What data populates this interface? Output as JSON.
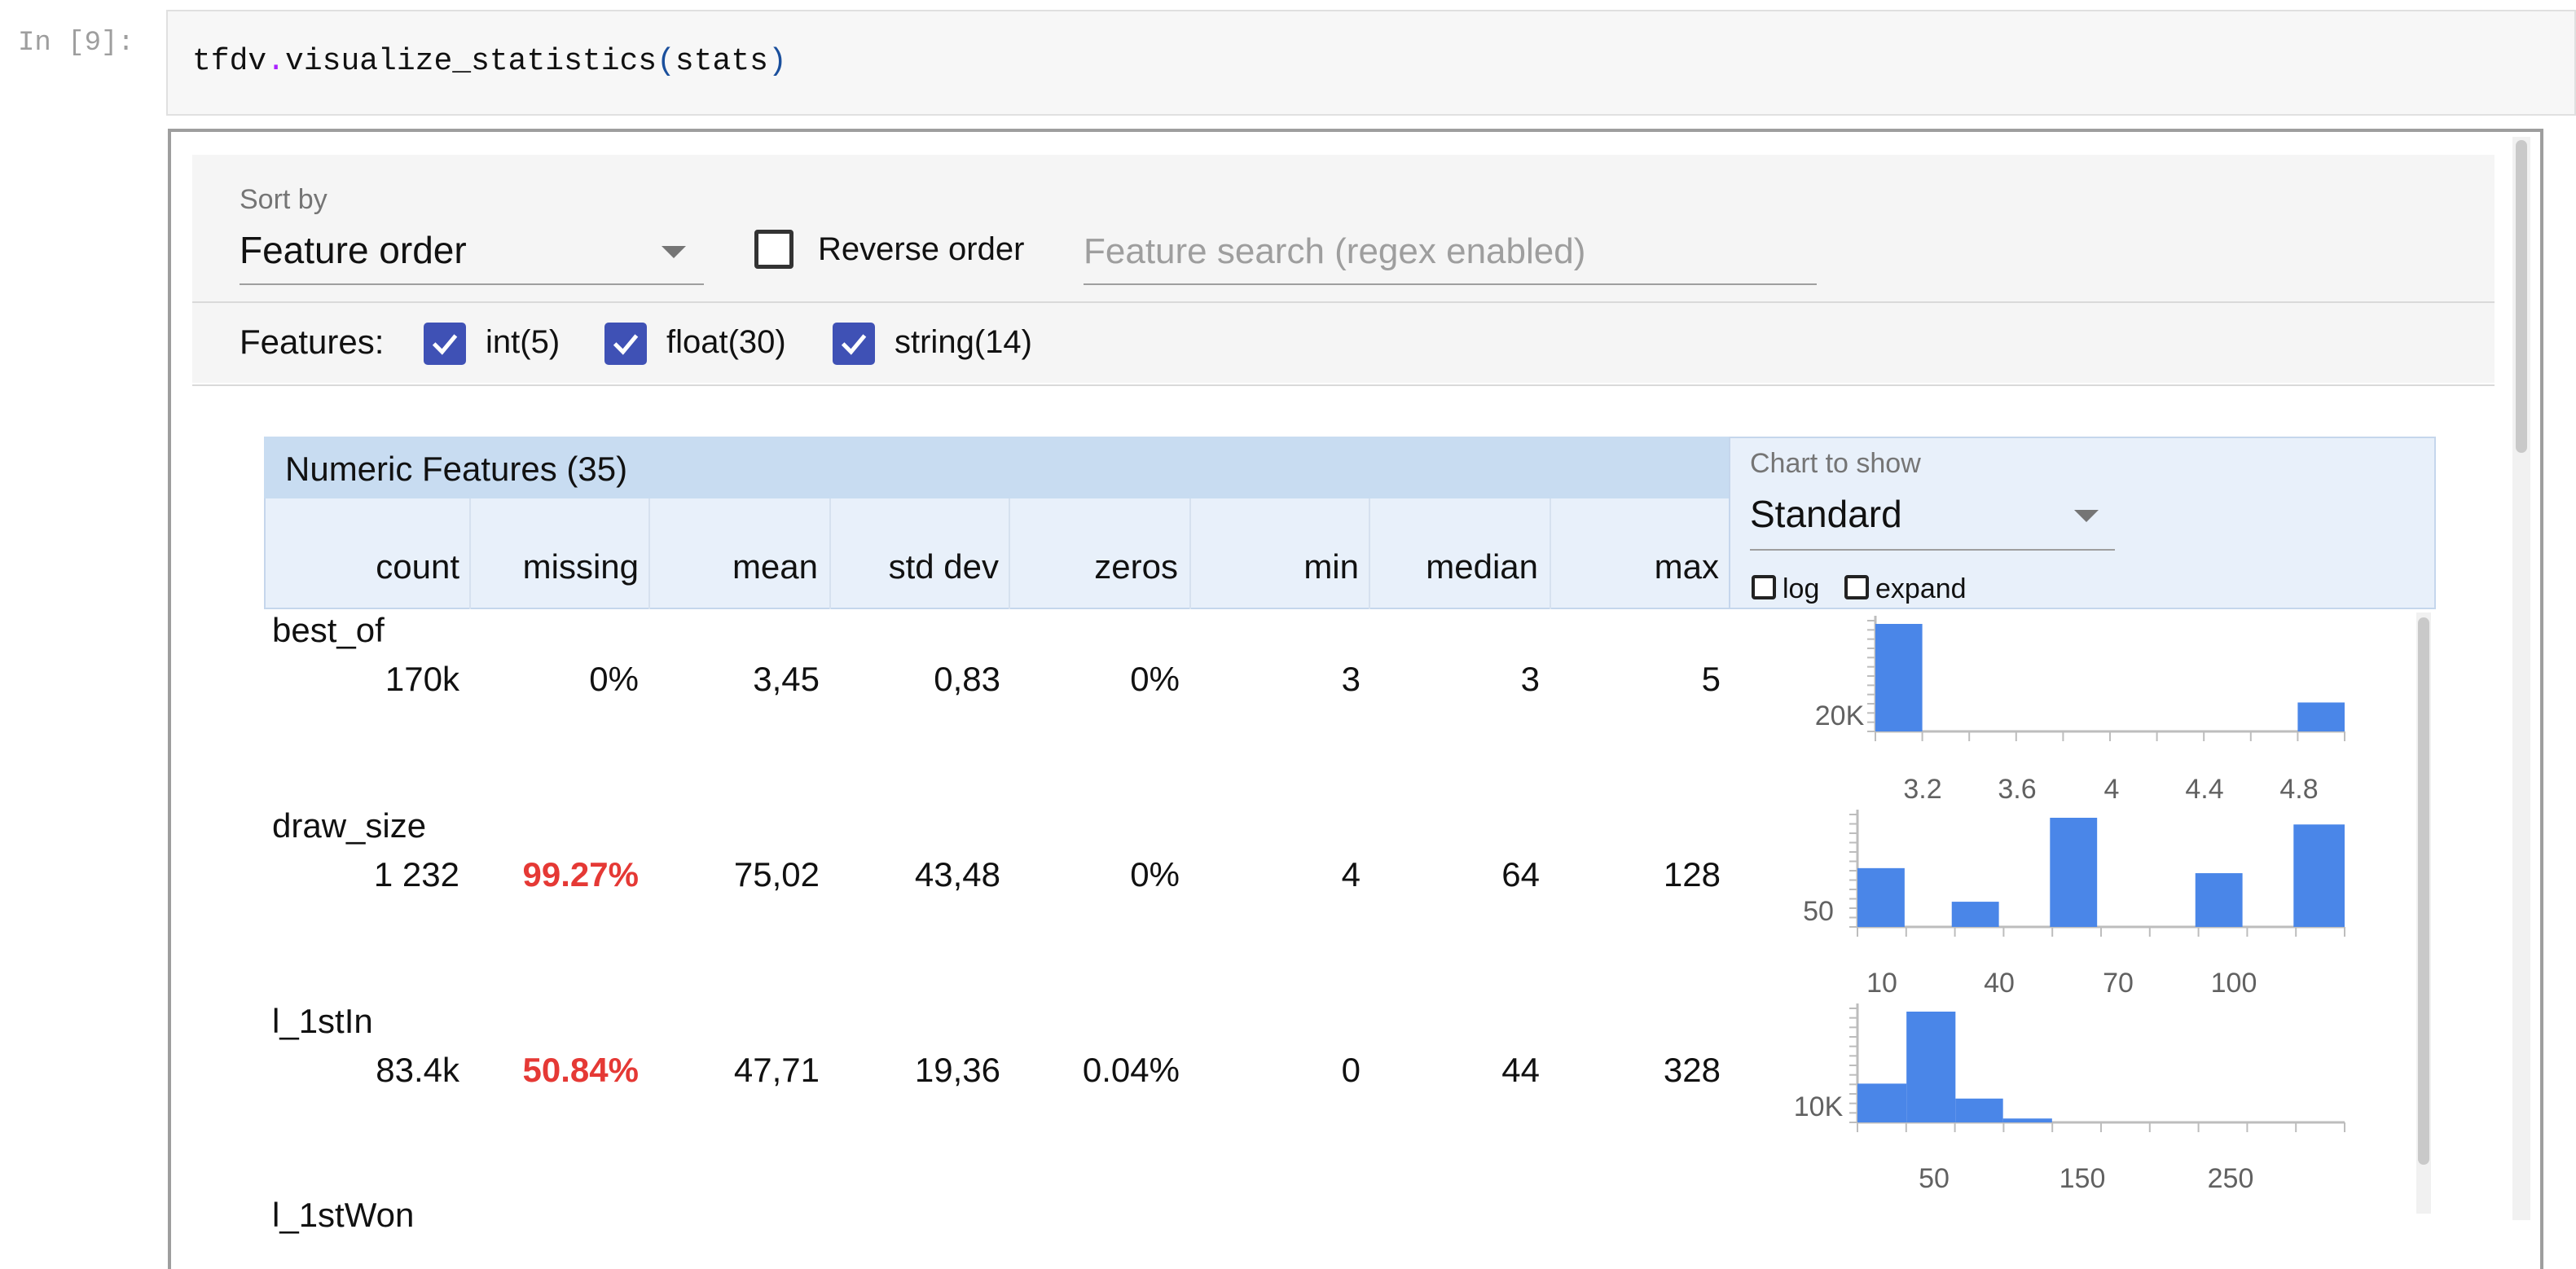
{
  "prompt": "In [9]:",
  "code": {
    "obj": "tfdv",
    "dot": ".",
    "func": "visualize_statistics",
    "open_paren": "(",
    "arg": "stats",
    "close_paren": ")"
  },
  "controls": {
    "sort_by_label": "Sort by",
    "sort_by_value": "Feature order",
    "reverse_label": "Reverse order",
    "reverse_checked": false,
    "search_placeholder": "Feature search (regex enabled)",
    "features_label": "Features:",
    "feature_types": [
      {
        "label": "int(5)",
        "checked": true
      },
      {
        "label": "float(30)",
        "checked": true
      },
      {
        "label": "string(14)",
        "checked": true
      }
    ]
  },
  "table": {
    "title": "Numeric Features (35)",
    "columns": [
      "count",
      "missing",
      "mean",
      "std dev",
      "zeros",
      "min",
      "median",
      "max"
    ],
    "chart_label": "Chart to show",
    "chart_value": "Standard",
    "log_label": "log",
    "expand_label": "expand",
    "rows": [
      {
        "name": "best_of",
        "values": [
          "170k",
          "0%",
          "3,45",
          "0,83",
          "0%",
          "3",
          "3",
          "5"
        ],
        "missing_alert": false
      },
      {
        "name": "draw_size",
        "values": [
          "1 232",
          "99.27%",
          "75,02",
          "43,48",
          "0%",
          "4",
          "64",
          "128"
        ],
        "missing_alert": true
      },
      {
        "name": "l_1stIn",
        "values": [
          "83.4k",
          "50.84%",
          "47,71",
          "19,36",
          "0.04%",
          "0",
          "44",
          "328"
        ],
        "missing_alert": true
      },
      {
        "name": "l_1stWon",
        "values": [],
        "missing_alert": false
      }
    ]
  },
  "colors": {
    "bar": "#4a86e8",
    "alert": "#e53935",
    "checkbox": "#3f51b5",
    "header_bg": "#e8f0fa",
    "title_bg": "#c8dcf1"
  },
  "chart_data": [
    {
      "type": "bar",
      "feature": "best_of",
      "ytick_labels": [
        "20K"
      ],
      "xtick_labels": [
        "3.2",
        "3.6",
        "4",
        "4.4",
        "4.8"
      ],
      "xlim": [
        3,
        5
      ],
      "bars": [
        {
          "x0": 3.0,
          "x1": 3.2,
          "value": 52000
        },
        {
          "x0": 4.8,
          "x1": 5.0,
          "value": 14000
        }
      ],
      "ylim": [
        0,
        52000
      ]
    },
    {
      "type": "bar",
      "feature": "draw_size",
      "ytick_labels": [
        "50"
      ],
      "xtick_labels": [
        "10",
        "40",
        "70",
        "100"
      ],
      "xlim": [
        4,
        128
      ],
      "bars": [
        {
          "x0": 4,
          "x1": 16,
          "value": 140
        },
        {
          "x0": 28,
          "x1": 40,
          "value": 60
        },
        {
          "x0": 53,
          "x1": 65,
          "value": 260
        },
        {
          "x0": 90,
          "x1": 102,
          "value": 128
        },
        {
          "x0": 115,
          "x1": 128,
          "value": 244
        }
      ],
      "ylim": [
        0,
        260
      ]
    },
    {
      "type": "bar",
      "feature": "l_1stIn",
      "ytick_labels": [
        "10K"
      ],
      "xtick_labels": [
        "50",
        "150",
        "250"
      ],
      "xlim": [
        0,
        328
      ],
      "bars": [
        {
          "x0": 0,
          "x1": 33,
          "value": 7000
        },
        {
          "x0": 33,
          "x1": 66,
          "value": 20000
        },
        {
          "x0": 66,
          "x1": 98,
          "value": 4300
        },
        {
          "x0": 98,
          "x1": 131,
          "value": 700
        }
      ],
      "ylim": [
        0,
        20000
      ]
    }
  ]
}
